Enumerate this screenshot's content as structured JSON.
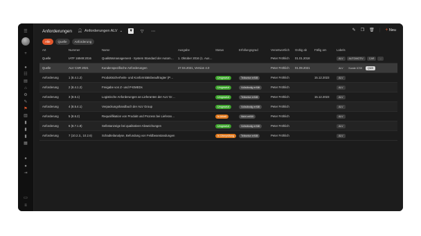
{
  "sidebar": {
    "menu_icon": "hamburger-icon",
    "add_icon": "plus-icon",
    "icons": [
      "info-icon",
      "list-icon",
      "document-icon",
      "home-icon",
      "gear-icon",
      "wrench-icon",
      "flag-icon",
      "chart-icon",
      "file-icon",
      "file-icon",
      "file-icon",
      "folder-icon",
      "book-icon",
      "info-icon",
      "help-icon",
      "logout-icon",
      "folder-icon",
      "database-icon"
    ]
  },
  "header": {
    "title": "Anforderungen",
    "view_label": "Anforderungen ALV",
    "new_label": "Neu"
  },
  "chips": [
    "Alle",
    "Quelle",
    "Anforderung"
  ],
  "table": {
    "columns": [
      "Art",
      "Nummer",
      "Name",
      "Ausgabe",
      "Status",
      "Erfüllungsgrad",
      "Verantwortlich",
      "Gültig ab",
      "Fällig am",
      "Labels"
    ],
    "rows": [
      {
        "art": "Quelle",
        "nummer": "IATF 16949:2016",
        "name": "Qualitätsmanagement - System Standard der Automobil...",
        "ausgabe": "1. Oktober 2016 (1. Ausg...",
        "status": "",
        "erfuellung": "",
        "verantwortlich": "Peter Fröhlich",
        "gueltig": "01.01.2018",
        "faellig": "",
        "labels": [
          "ALV",
          "AUTOMOTIV",
          "CAR",
          "..."
        ]
      },
      {
        "art": "Quelle",
        "nummer": "ALV CSR 2021",
        "name": "Kundenspezifische Anforderungen",
        "ausgabe": "27.04.2021, Version 4.0",
        "status": "",
        "erfuellung": "",
        "verantwortlich": "Peter Fröhlich",
        "gueltig": "01.09.2021",
        "faellig": "",
        "labels": [
          "ALV",
          "Kunde ICS9",
          "QMS"
        ]
      },
      {
        "art": "Anforderung",
        "nummer": "1 (8.4.1.2)",
        "name": "Produktsicherheits- und Konformitätsbeauftragter (PSCR)",
        "ausgabe": "",
        "status": "Umgesetzt",
        "erfuellung": "Teilweise erfüllt",
        "verantwortlich": "Peter Fröhlich",
        "gueltig": "",
        "faellig": "15.12.2023",
        "labels": [
          "ALV"
        ]
      },
      {
        "art": "Anforderung",
        "nummer": "2 (8.4.1.2)",
        "name": "Freigabe von Z- und P-EMEDs",
        "ausgabe": "",
        "status": "Umgesetzt",
        "erfuellung": "Vollständig erfüllt",
        "verantwortlich": "Peter Fröhlich",
        "gueltig": "",
        "faellig": "",
        "labels": [
          "ALV"
        ]
      },
      {
        "art": "Anforderung",
        "nummer": "3 (8.5.1)",
        "name": "Logistische Anforderungen an Lieferanten der ALV Group",
        "ausgabe": "",
        "status": "Umgesetzt",
        "erfuellung": "Teilweise erfüllt",
        "verantwortlich": "Peter Fröhlich",
        "gueltig": "",
        "faellig": "15.12.2023",
        "labels": [
          "ALV"
        ]
      },
      {
        "art": "Anforderung",
        "nummer": "4 (8.5.4.1)",
        "name": "Verpackungshandbuch der ALV Group",
        "ausgabe": "",
        "status": "Umgesetzt",
        "erfuellung": "Vollständig erfüllt",
        "verantwortlich": "Peter Fröhlich",
        "gueltig": "",
        "faellig": "",
        "labels": [
          "ALV"
        ]
      },
      {
        "art": "Anforderung",
        "nummer": "5 (8.6.2)",
        "name": "Requalifikation von Produkt und Prozess bei Lieferanten",
        "ausgabe": "",
        "status": "In Arbeit",
        "erfuellung": "Nicht erfüllt",
        "verantwortlich": "Peter Fröhlich",
        "gueltig": "",
        "faellig": "",
        "labels": [
          "ALV"
        ]
      },
      {
        "art": "Anforderung",
        "nummer": "6 (8.7.1.8)",
        "name": "Selbstanzeige bei qualitativen Abweichungen",
        "ausgabe": "",
        "status": "Umgesetzt",
        "erfuellung": "Vollständig erfüllt",
        "verantwortlich": "Peter Fröhlich",
        "gueltig": "",
        "faellig": "",
        "labels": [
          "ALV"
        ]
      },
      {
        "art": "Anforderung",
        "nummer": "7 (10.2.3., 10.2.6)",
        "name": "Schadteilanalyse, Befundung von Feldbeanstandungen",
        "ausgabe": "",
        "status": "In Überprüfung",
        "erfuellung": "Teilweise erfüllt",
        "verantwortlich": "Peter Fröhlich",
        "gueltig": "",
        "faellig": "",
        "labels": [
          "ALV"
        ]
      }
    ]
  }
}
